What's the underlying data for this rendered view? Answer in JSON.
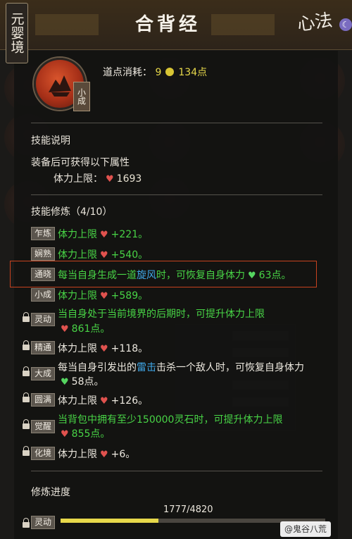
{
  "header": {
    "realm": "元婴境",
    "title": "合背经",
    "brand": "心法",
    "pin_icon": "moon-icon"
  },
  "skill": {
    "rank": "小成",
    "cost_label": "道点消耗：",
    "cost_coin": "9",
    "cost_points": "134点"
  },
  "description": {
    "title": "技能说明",
    "lead": "装备后可获得以下属性",
    "stat_label": "体力上限：",
    "stat_value": "1693"
  },
  "training": {
    "title": "技能修炼（4/10）",
    "levels": [
      {
        "tag": "乍炼",
        "text": "体力上限",
        "value": "+221。",
        "locked": false
      },
      {
        "tag": "娴熟",
        "text": "体力上限",
        "value": "+540。",
        "locked": false
      },
      {
        "tag": "通晓",
        "text_a": "每当自身生成一道",
        "text_b": "旋风",
        "text_c": "时，可恢复自身体力",
        "value": "63点。",
        "locked": false
      },
      {
        "tag": "小成",
        "text": "体力上限",
        "value": "+589。",
        "locked": false
      },
      {
        "tag": "灵动",
        "text": "当自身处于当前境界的后期时，可提升体力上限",
        "value": "861点。",
        "locked": true
      },
      {
        "tag": "精通",
        "text": "体力上限",
        "value": "+118。",
        "locked": true
      },
      {
        "tag": "大成",
        "text_a": "每当自身引发出的",
        "text_b": "雷击",
        "text_c": "击杀一个敌人时，可恢复自身体力",
        "value": "58点。",
        "locked": true
      },
      {
        "tag": "圆满",
        "text": "体力上限",
        "value": "+126。",
        "locked": true
      },
      {
        "tag": "觉醒",
        "text": "当背包中拥有至少150000灵石时，可提升体力上限",
        "value": "855点。",
        "locked": true
      },
      {
        "tag": "化境",
        "text": "体力上限",
        "value": "+6。",
        "locked": true
      }
    ]
  },
  "progress": {
    "title": "修炼进度",
    "next_tag": "灵动",
    "count": "1777/4820",
    "fraction": 0.3687
  },
  "watermark": "@鬼谷八荒"
}
